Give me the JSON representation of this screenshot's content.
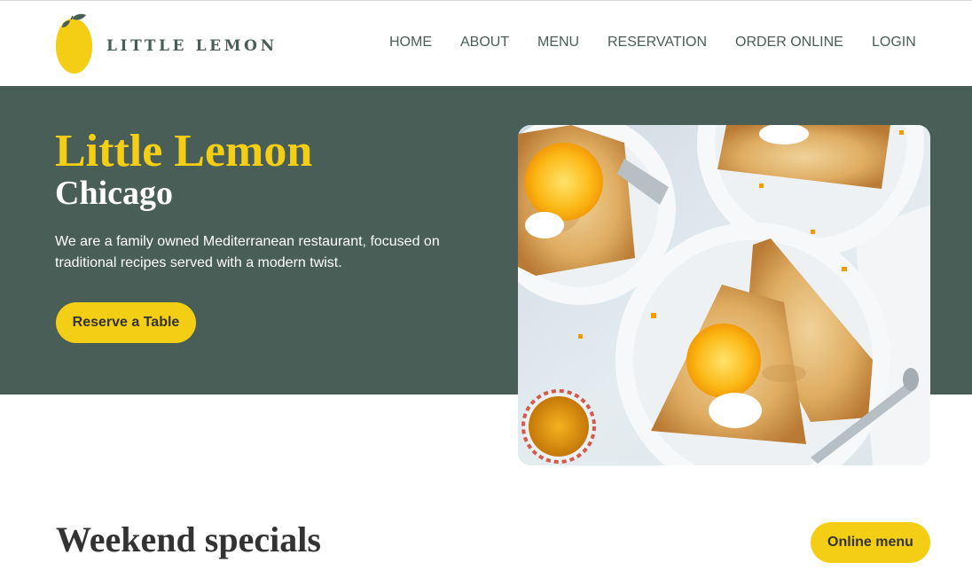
{
  "brand": {
    "name": "LITTLE LEMON"
  },
  "nav": {
    "home": "HOME",
    "about": "ABOUT",
    "menu": "MENU",
    "reservation": "RESERVATION",
    "order_online": "ORDER ONLINE",
    "login": "LOGIN"
  },
  "hero": {
    "title": "Little Lemon",
    "subtitle": "Chicago",
    "description": "We are a family owned Mediterranean restaurant, focused on traditional recipes served with a modern twist.",
    "cta": "Reserve a Table"
  },
  "specials": {
    "title": "Weekend specials",
    "cta": "Online menu"
  },
  "colors": {
    "primary_green": "#495e57",
    "primary_yellow": "#f4ce14",
    "text_dark": "#333333",
    "white": "#ffffff"
  },
  "icons": {
    "logo": "lemon-logo-icon"
  }
}
